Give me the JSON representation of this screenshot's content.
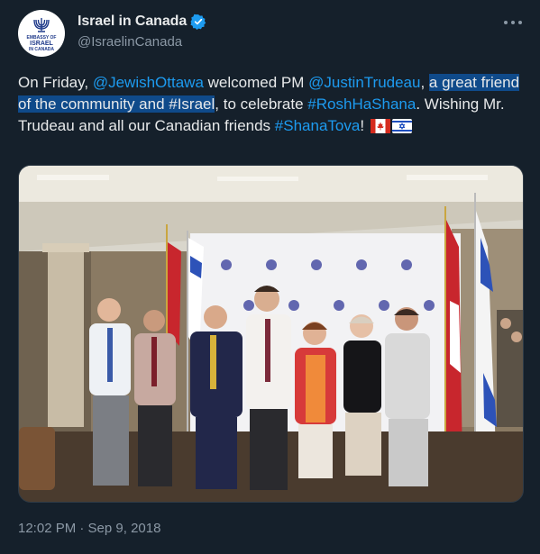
{
  "account": {
    "display_name": "Israel in Canada",
    "handle": "@IsraelinCanada",
    "verified": true,
    "avatar": {
      "line1": "EMBASSY OF",
      "line2": "ISRAEL",
      "line3": "IN CANADA"
    }
  },
  "tweet": {
    "segments": [
      {
        "text": "On Friday, ",
        "style": "plain"
      },
      {
        "text": "@JewishOttawa",
        "style": "link"
      },
      {
        "text": " welcomed PM ",
        "style": "plain"
      },
      {
        "text": "@JustinTrudeau",
        "style": "link"
      },
      {
        "text": ", ",
        "style": "plain"
      },
      {
        "text": "a great friend of the community and #Israel",
        "style": "highlight"
      },
      {
        "text": ", to celebrate ",
        "style": "plain"
      },
      {
        "text": "#RoshHaShana",
        "style": "link"
      },
      {
        "text": ". Wishing Mr. Trudeau and all our Canadian friends ",
        "style": "plain"
      },
      {
        "text": "#ShanaTova",
        "style": "link"
      },
      {
        "text": "! ",
        "style": "plain"
      }
    ],
    "emoji": [
      "canada-flag-icon",
      "israel-flag-icon"
    ],
    "timestamp": "12:02 PM · Sep 9, 2018"
  },
  "media": {
    "description": "group-photo",
    "backdrop_logo": "jewish-federation-logo-icon"
  },
  "colors": {
    "background": "#15202b",
    "link": "#1d9bf0",
    "muted": "#8b98a5",
    "highlight": "#0f4a8a"
  }
}
